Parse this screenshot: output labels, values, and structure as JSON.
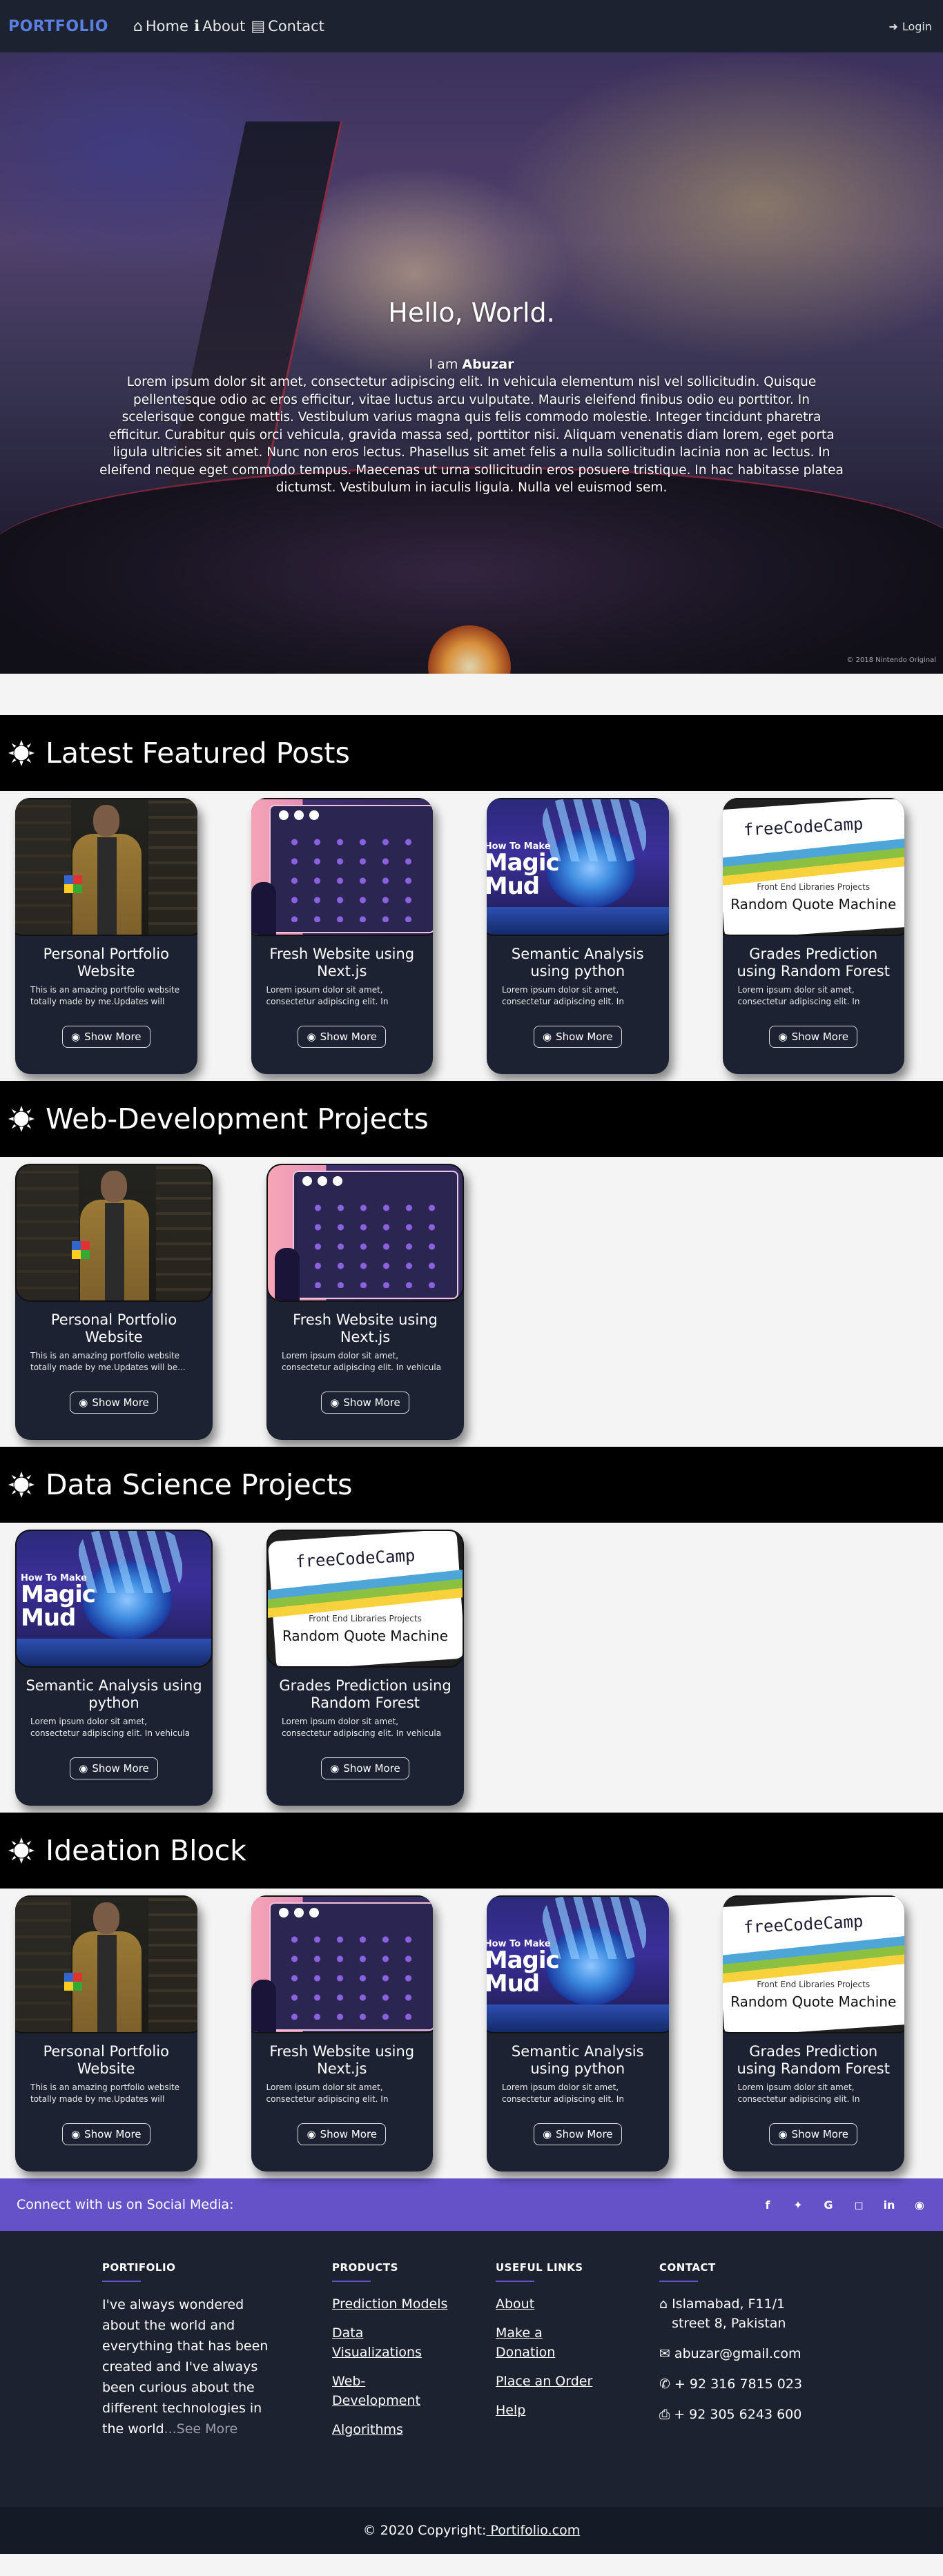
{
  "nav": {
    "brand": "PORTFOLIO",
    "home": "Home",
    "about": "About",
    "contact": "Contact",
    "login": "Login"
  },
  "hero": {
    "title": "Hello, World.",
    "iam_prefix": "I am",
    "name": "Abuzar",
    "text": "Lorem ipsum dolor sit amet, consectetur adipiscing elit. In vehicula elementum nisl vel sollicitudin. Quisque pellentesque odio ac eros efficitur, vitae luctus arcu vulputate. Mauris eleifend finibus odio eu porttitor. In scelerisque congue mattis. Vestibulum varius magna quis felis commodo molestie. Integer tincidunt pharetra efficitur. Curabitur quis orci vehicula, gravida massa sed, porttitor nisi. Aliquam venenatis diam lorem, eget porta ligula ultricies sit amet. Nunc non eros lectus. Phasellus sit amet felis a nulla sollicitudin lacinia non ac lectus. In eleifend neque eget commodo tempus. Maecenas ut urna sollicitudin eros posuere tristique. In hac habitasse platea dictumst. Vestibulum in iaculis ligula. Nulla vel euismod sem.",
    "image_credit": "© 2018 Nintendo Original"
  },
  "cards": {
    "portfolio": {
      "title": "Personal Portfolio Website",
      "desc": "This is an amazing portfolio website totally made by me.Updates will be..."
    },
    "nextjs": {
      "title": "Fresh Website using Next.js",
      "desc": "Lorem ipsum dolor sit amet, consectetur adipiscing elit. In vehicula elementum..."
    },
    "semantic": {
      "title": "Semantic Analysis using python",
      "desc": "Lorem ipsum dolor sit amet, consectetur adipiscing elit. In vehicula elementum..."
    },
    "grades": {
      "title": "Grades Prediction using Random Forest",
      "desc": "Lorem ipsum dolor sit amet, consectetur adipiscing elit. In vehicula elementum..."
    },
    "show_more": "Show More",
    "art": {
      "mud_small": "How To Make",
      "mud_big1": "Magic",
      "mud_big2": "Mud",
      "fcc_logo": "freeCodeCamp",
      "fcc_sub": "Front End Libraries Projects",
      "fcc_title": "Random Quote Machine"
    }
  },
  "sections": {
    "featured": "Latest Featured Posts",
    "webdev": "Web-Development Projects",
    "datasci": "Data Science Projects",
    "ideation": "Ideation Block"
  },
  "social": {
    "text": "Connect with us on Social Media:",
    "icons": [
      "facebook-icon",
      "twitter-icon",
      "google-icon",
      "instagram-icon",
      "linkedin-icon",
      "github-icon"
    ]
  },
  "footer": {
    "portfolio_head": "PORTIFOLIO",
    "about_text": "I've always wondered about the world and everything that has been created and I've always been curious about the different technologies in the world",
    "see_more": "...See More",
    "products_head": "PRODUCTS",
    "products": [
      "Prediction Models",
      "Data Visualizations",
      "Web-Development",
      "Algorithms"
    ],
    "useful_head": "USEFUL LINKS",
    "useful": [
      "About",
      "Make a Donation",
      "Place an Order",
      "Help"
    ],
    "contact_head": "CONTACT",
    "address": "Islamabad, F11/1 street 8, Pakistan",
    "email": "abuzar@gmail.com",
    "phone": "+ 92 316 7815 023",
    "fax": "+ 92 305 6243 600",
    "copyright_prefix": "© 2020 Copyright:",
    "copyright_link": " Portifolio.com"
  },
  "colors": {
    "navbar": "#1c2230",
    "brand": "#5b7fe0",
    "card_bg": "#1c2231",
    "section_header": "#000000",
    "social_bar": "#6552c8",
    "footer": "#1d2231",
    "bottom_bar": "#151a27"
  }
}
